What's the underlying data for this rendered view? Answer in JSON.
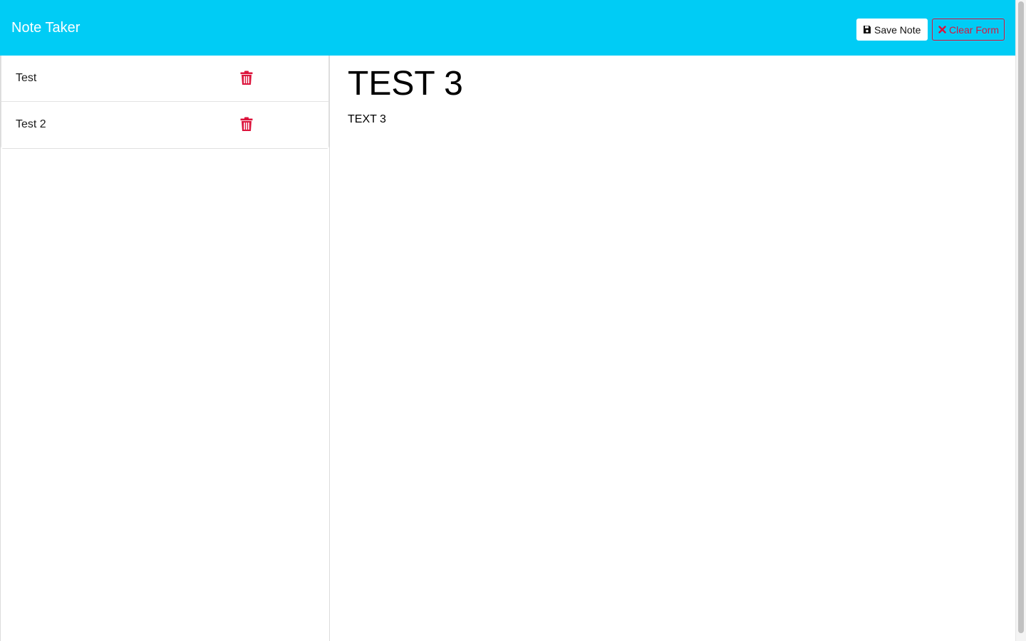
{
  "app": {
    "title": "Note Taker"
  },
  "toolbar": {
    "save_label": "Save Note",
    "save_icon": "save-icon",
    "clear_label": "Clear Form",
    "clear_icon": "close-icon"
  },
  "sidebar": {
    "notes": [
      {
        "title": "Test",
        "delete_icon": "trash-icon"
      },
      {
        "title": "Test 2",
        "delete_icon": "trash-icon"
      }
    ]
  },
  "editor": {
    "title_value": "TEST 3",
    "text_value": "TEXT 3"
  },
  "colors": {
    "navbar": "#00ccf5",
    "danger": "#dc143c",
    "brand_text": "#ffffff"
  }
}
